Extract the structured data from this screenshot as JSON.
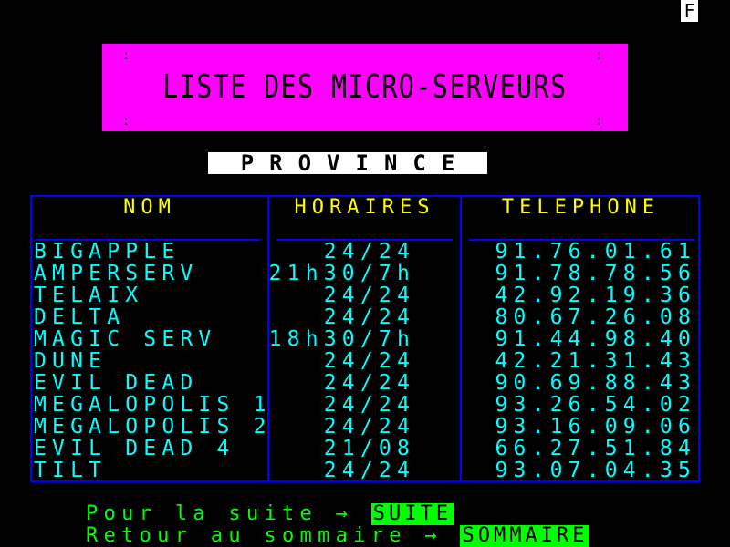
{
  "corner_label": "F",
  "title": "LISTE DES MICRO-SERVEURS",
  "subtitle": "PROVINCE",
  "table": {
    "headers": {
      "name": "NOM",
      "hours": "HORAIRES",
      "phone": "TELEPHONE"
    },
    "rows": [
      {
        "name": "BIGAPPLE",
        "hours": "24/24",
        "phone": "91.76.01.61"
      },
      {
        "name": "AMPERSERV",
        "hours": "21h30/7h",
        "phone": "91.78.78.56"
      },
      {
        "name": "TELAIX",
        "hours": "24/24",
        "phone": "42.92.19.36"
      },
      {
        "name": "DELTA",
        "hours": "24/24",
        "phone": "80.67.26.08"
      },
      {
        "name": "MAGIC SERV",
        "hours": "18h30/7h",
        "phone": "91.44.98.40"
      },
      {
        "name": "DUNE",
        "hours": "24/24",
        "phone": "42.21.31.43"
      },
      {
        "name": "EVIL DEAD",
        "hours": "24/24",
        "phone": "90.69.88.43"
      },
      {
        "name": "MEGALOPOLIS 1",
        "hours": "24/24",
        "phone": "93.26.54.02"
      },
      {
        "name": "MEGALOPOLIS 2",
        "hours": "24/24",
        "phone": "93.16.09.06"
      },
      {
        "name": "EVIL DEAD 4",
        "hours": "21/08",
        "phone": "66.27.51.84"
      },
      {
        "name": "TILT",
        "hours": "24/24",
        "phone": "93.07.04.35"
      }
    ]
  },
  "footer": {
    "next_text": "Pour la suite →",
    "next_key": "SUITE",
    "back_text": "Retour au sommaire →",
    "back_key": "SOMMAIRE"
  },
  "colors": {
    "background": "#000000",
    "title_background": "#ff00ff",
    "table_border": "#0000ff",
    "header_text": "#ffff00",
    "row_text": "#00ffff",
    "footer_text": "#00ff00"
  }
}
